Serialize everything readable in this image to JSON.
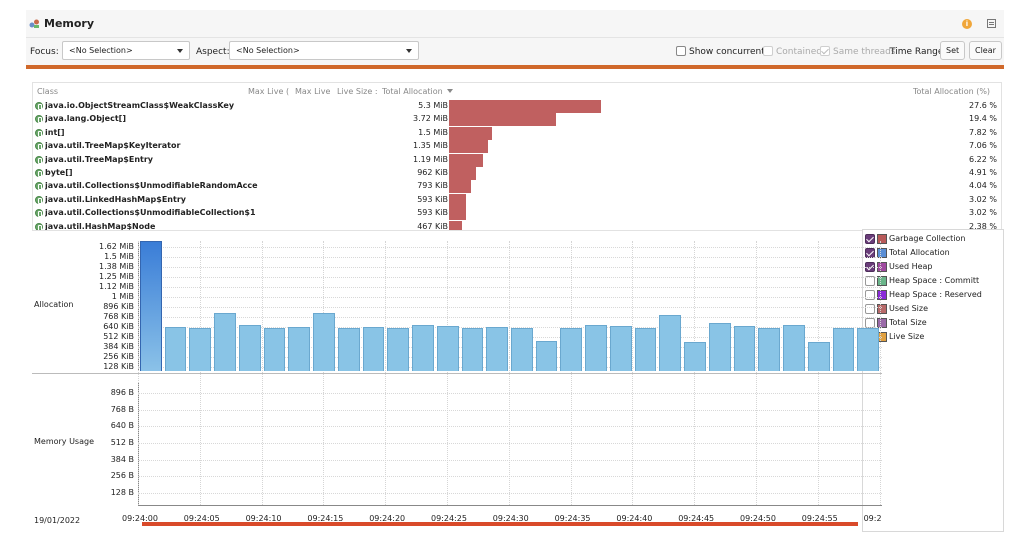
{
  "header": {
    "title": "Memory",
    "colors": {
      "accent_orange": "#d0682a",
      "accent_red": "#d94a2a",
      "alloc_bar": "#c06060",
      "chart_bar": "#89c4e6"
    }
  },
  "toolbar": {
    "focus_label": "Focus:",
    "focus_value": "<No Selection>",
    "aspect_label": "Aspect:",
    "aspect_value": "<No Selection>",
    "show_concurrent": "Show concurrent:",
    "contained": "Contained",
    "same_threads": "Same threads",
    "time_range": "Time Range:",
    "set_label": "Set",
    "clear_label": "Clear"
  },
  "table": {
    "headers": {
      "class": "Class",
      "max_live_count": "Max Live (",
      "max_live_size": "Max Live",
      "live_size": "Live Size :",
      "total_allocation": "Total Allocation",
      "total_allocation_pct": "Total Allocation (%)"
    },
    "rows": [
      {
        "name": "java.io.ObjectStreamClass$WeakClassKey",
        "value": "5.3 MiB",
        "pct": "27.6 %",
        "frac": 0.276
      },
      {
        "name": "java.lang.Object[]",
        "value": "3.72 MiB",
        "pct": "19.4 %",
        "frac": 0.194
      },
      {
        "name": "int[]",
        "value": "1.5 MiB",
        "pct": "7.82 %",
        "frac": 0.0782
      },
      {
        "name": "java.util.TreeMap$KeyIterator",
        "value": "1.35 MiB",
        "pct": "7.06 %",
        "frac": 0.0706
      },
      {
        "name": "java.util.TreeMap$Entry",
        "value": "1.19 MiB",
        "pct": "6.22 %",
        "frac": 0.0622
      },
      {
        "name": "byte[]",
        "value": "962 KiB",
        "pct": "4.91 %",
        "frac": 0.0491
      },
      {
        "name": "java.util.Collections$UnmodifiableRandomAcce",
        "value": "793 KiB",
        "pct": "4.04 %",
        "frac": 0.0404
      },
      {
        "name": "java.util.LinkedHashMap$Entry",
        "value": "593 KiB",
        "pct": "3.02 %",
        "frac": 0.0302
      },
      {
        "name": "java.util.Collections$UnmodifiableCollection$1",
        "value": "593 KiB",
        "pct": "3.02 %",
        "frac": 0.0302
      },
      {
        "name": "java.util.HashMap$Node",
        "value": "467 KiB",
        "pct": "2.38 %",
        "frac": 0.0238
      }
    ]
  },
  "chart": {
    "allocation_label": "Allocation",
    "memory_usage_label": "Memory Usage",
    "date_label": "19/01/2022",
    "alloc_ticks": [
      "1.62 MiB",
      "1.5 MiB",
      "1.38 MiB",
      "1.25 MiB",
      "1.12 MiB",
      "1 MiB",
      "896 KiB",
      "768 KiB",
      "640 KiB",
      "512 KiB",
      "384 KiB",
      "256 KiB",
      "128 KiB"
    ],
    "mem_ticks": [
      "896 B",
      "768 B",
      "640 B",
      "512 B",
      "384 B",
      "256 B",
      "128 B"
    ],
    "x_ticks": [
      "09:24:00",
      "09:24:05",
      "09:24:10",
      "09:24:15",
      "09:24:20",
      "09:24:25",
      "09:24:30",
      "09:24:35",
      "09:24:40",
      "09:24:45",
      "09:24:50",
      "09:24:55",
      "09:2"
    ]
  },
  "chart_data": {
    "type": "bar",
    "ylabel": "Allocation",
    "ylim": [
      0,
      1.68
    ],
    "unit": "MiB",
    "values": [
      1.68,
      0.57,
      0.55,
      0.75,
      0.6,
      0.55,
      0.57,
      0.75,
      0.55,
      0.57,
      0.55,
      0.59,
      0.58,
      0.55,
      0.57,
      0.55,
      0.39,
      0.55,
      0.6,
      0.58,
      0.55,
      0.72,
      0.37,
      0.62,
      0.58,
      0.55,
      0.6,
      0.37,
      0.55,
      0.55
    ],
    "grid": true
  },
  "legend": {
    "items": [
      {
        "label": "Garbage Collection",
        "checked": true,
        "color": "#b85a5a"
      },
      {
        "label": "Total Allocation",
        "checked": true,
        "color": "#5b8fd6"
      },
      {
        "label": "Used Heap",
        "checked": true,
        "color": "#a04aa0"
      },
      {
        "label": "Heap Space : Committ",
        "checked": false,
        "color": "#6ab58a"
      },
      {
        "label": "Heap Space : Reserved",
        "checked": false,
        "color": "#8a2ad8"
      },
      {
        "label": "Used Size",
        "checked": false,
        "color": "#b86a6a"
      },
      {
        "label": "Total Size",
        "checked": false,
        "color": "#9a6aa8"
      },
      {
        "label": "Live Size",
        "checked": false,
        "color": "#e0a040"
      }
    ]
  }
}
